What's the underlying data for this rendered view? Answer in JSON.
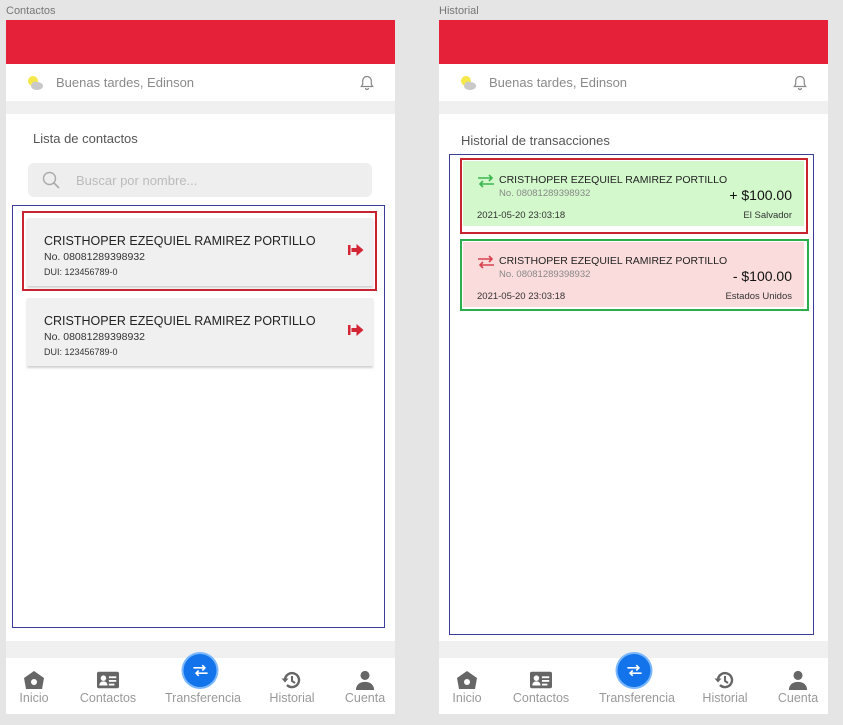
{
  "frames": {
    "left_label": "Contactos",
    "right_label": "Historial"
  },
  "greeting": "Buenas tardes, Edinson",
  "contacts": {
    "title": "Lista de contactos",
    "search_placeholder": "Buscar por nombre...",
    "items": [
      {
        "name": "CRISTHOPER EZEQUIEL RAMIREZ PORTILLO",
        "number": "No. 08081289398932",
        "dui": "DUI: 123456789-0"
      },
      {
        "name": "CRISTHOPER EZEQUIEL RAMIREZ PORTILLO",
        "number": "No. 08081289398932",
        "dui": "DUI: 123456789-0"
      }
    ]
  },
  "history": {
    "title": "Historial de transacciones",
    "items": [
      {
        "name": "CRISTHOPER EZEQUIEL RAMIREZ PORTILLO",
        "number": "No. 08081289398932",
        "amount": "+ $100.00",
        "date": "2021-05-20 23:03:18",
        "country": "El Salvador",
        "type": "incoming"
      },
      {
        "name": "CRISTHOPER EZEQUIEL RAMIREZ PORTILLO",
        "number": "No. 08081289398932",
        "amount": "- $100.00",
        "date": "2021-05-20 23:03:18",
        "country": "Estados Unidos",
        "type": "outgoing"
      }
    ]
  },
  "nav": {
    "inicio": "Inicio",
    "contactos": "Contactos",
    "transferencia": "Transferencia",
    "historial": "Historial",
    "cuenta": "Cuenta"
  },
  "icons": {
    "weather": "partly-cloudy-icon",
    "bell": "bell-icon",
    "search": "search-icon",
    "send": "send-arrow-icon",
    "transfer": "transfer-arrows-icon",
    "home": "home-icon",
    "contacts": "contact-card-icon",
    "history": "history-icon",
    "account": "person-icon"
  },
  "colors": {
    "brand_red": "#e5213a",
    "fab_blue": "#1273ea",
    "incoming_bg": "#d3f8cc",
    "outgoing_bg": "#fbdcdc"
  }
}
